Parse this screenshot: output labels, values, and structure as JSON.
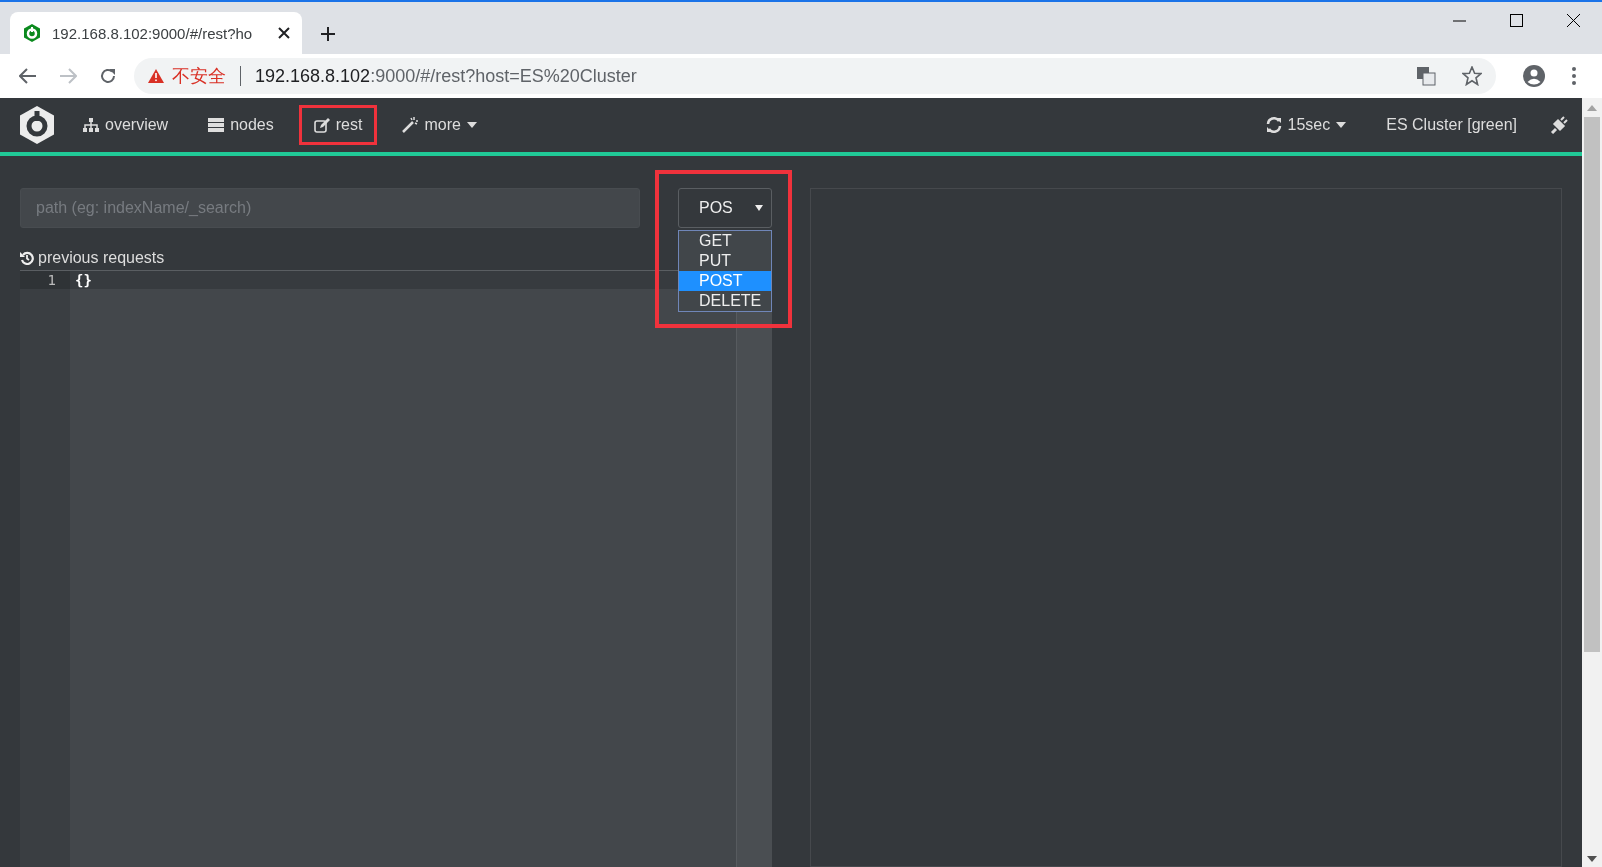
{
  "browser": {
    "tab_title": "192.168.8.102:9000/#/rest?ho",
    "security_label": "不安全",
    "url_host": "192.168.8.102",
    "url_rest": ":9000/#/rest?host=ES%20Cluster"
  },
  "nav": {
    "items": [
      {
        "label": "overview",
        "highlighted": false,
        "dropdown": false
      },
      {
        "label": "nodes",
        "highlighted": false,
        "dropdown": false
      },
      {
        "label": "rest",
        "highlighted": true,
        "dropdown": false
      },
      {
        "label": "more",
        "highlighted": false,
        "dropdown": true
      }
    ],
    "refresh": "15sec",
    "cluster": "ES Cluster [green]"
  },
  "request": {
    "path": {
      "placeholder": "path (eg: indexName/_search)"
    },
    "method": {
      "value": "POS",
      "highlighted": true,
      "expanded": true,
      "options": [
        {
          "label": "GET",
          "selected": false
        },
        {
          "label": "PUT",
          "selected": false
        },
        {
          "label": "POST",
          "selected": true
        },
        {
          "label": "DELETE",
          "selected": false
        }
      ]
    },
    "previous_requests": "previous requests",
    "editor": {
      "lines": [
        {
          "number": "1",
          "text": "{}"
        }
      ]
    }
  }
}
